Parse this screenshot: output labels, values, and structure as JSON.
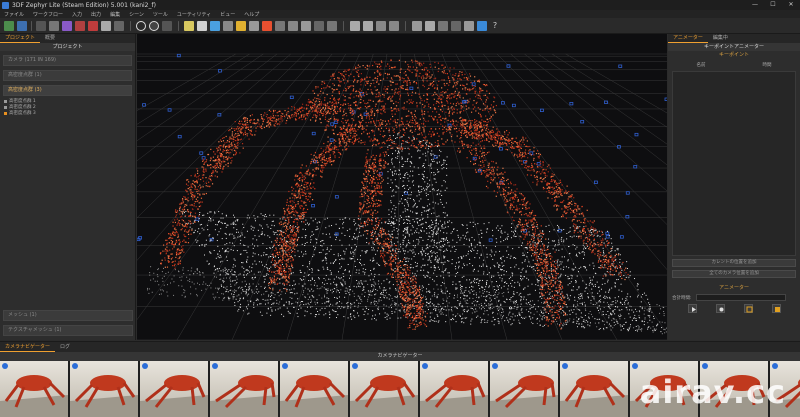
{
  "window": {
    "title": "3DF Zephyr Lite (Steam Edition) 5.001 (kani2_f)",
    "controls": [
      "—",
      "☐",
      "✕"
    ]
  },
  "menu": [
    "ファイル",
    "ワークフロー",
    "入力",
    "出力",
    "編集",
    "シーン",
    "ツール",
    "ユーティリティ",
    "ビュー",
    "ヘルプ"
  ],
  "left_panel": {
    "tabs": [
      "プロジェクト",
      "概要"
    ],
    "header": "プロジェクト",
    "items": [
      "カメラ (171 IN 169)",
      "高密度点群 (1)",
      "高密度点群 (3)"
    ],
    "clouds": [
      "高密度点群 1",
      "高密度点群 2",
      "高密度点群 3"
    ],
    "bottom_items": [
      "メッシュ (1)",
      "テクスチャメッシュ (1)"
    ]
  },
  "right_panel": {
    "tabs": [
      "アニメーター",
      "編集中"
    ],
    "header": "キーポイントアニメーター",
    "keypoint_header": "キーポイント",
    "columns": [
      "名前",
      "時間"
    ],
    "add_current": "カレントの位置を追加",
    "add_all": "全てのカメラ位置を追加",
    "animator_header": "アニメーター",
    "duration_label": "合計時間:"
  },
  "bottom": {
    "tabs": [
      "カメラナビゲーター",
      "ログ"
    ],
    "header": "カメラナビゲーター",
    "watermark": "airav.cc"
  },
  "colors": {
    "accent": "#f0a030",
    "crab": "#c8381c",
    "points": "#e8e8e8"
  }
}
